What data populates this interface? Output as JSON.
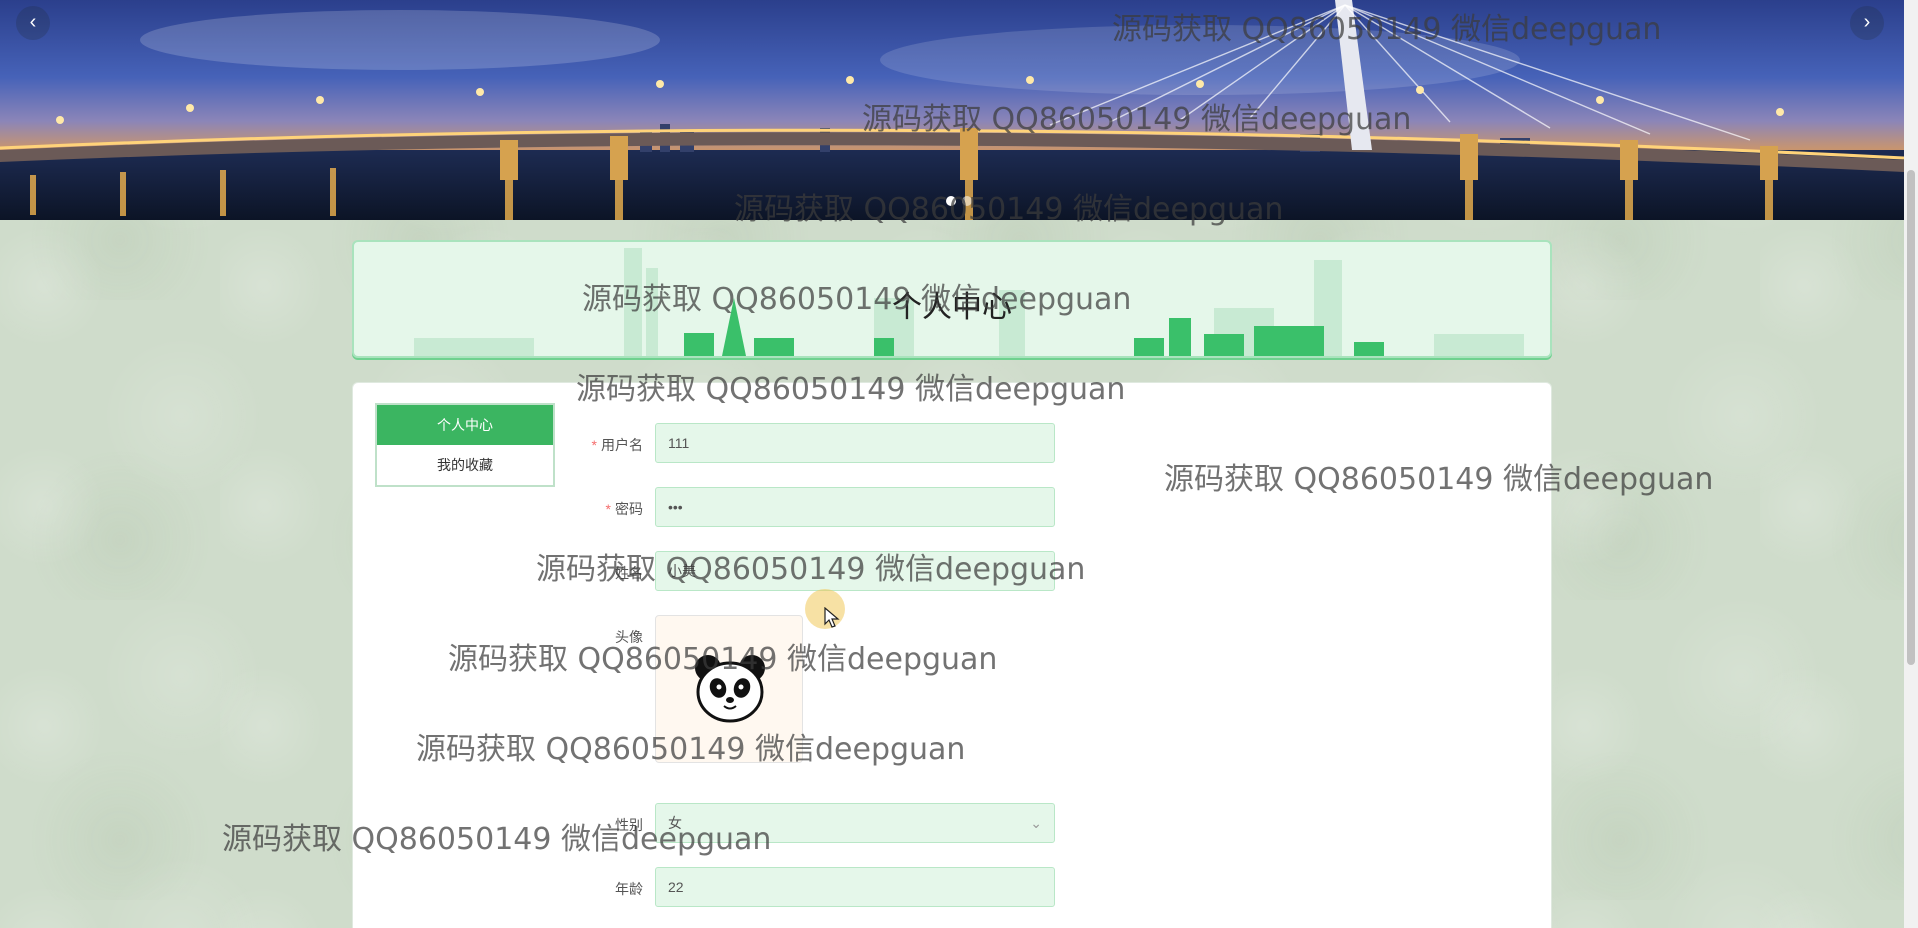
{
  "banner": {
    "prev_icon": "‹",
    "next_icon": "›",
    "dots": 2,
    "active_dot": 0
  },
  "page": {
    "title": "个人中心"
  },
  "side_menu": {
    "items": [
      {
        "label": "个人中心",
        "active": true
      },
      {
        "label": "我的收藏",
        "active": false
      }
    ]
  },
  "form": {
    "username": {
      "label": "用户名",
      "required": true,
      "value": "111"
    },
    "password": {
      "label": "密码",
      "required": true,
      "value": "•••"
    },
    "name": {
      "label": "姓名",
      "value": "小美"
    },
    "avatar": {
      "label": "头像"
    },
    "gender": {
      "label": "性别",
      "value": "女"
    },
    "age": {
      "label": "年龄",
      "value": "22"
    }
  },
  "watermark": {
    "text": "源码获取 QQ86050149 微信deepguan"
  },
  "colors": {
    "accent": "#3bb561",
    "input_bg": "#e5f7ea",
    "required": "#f56c6c"
  }
}
